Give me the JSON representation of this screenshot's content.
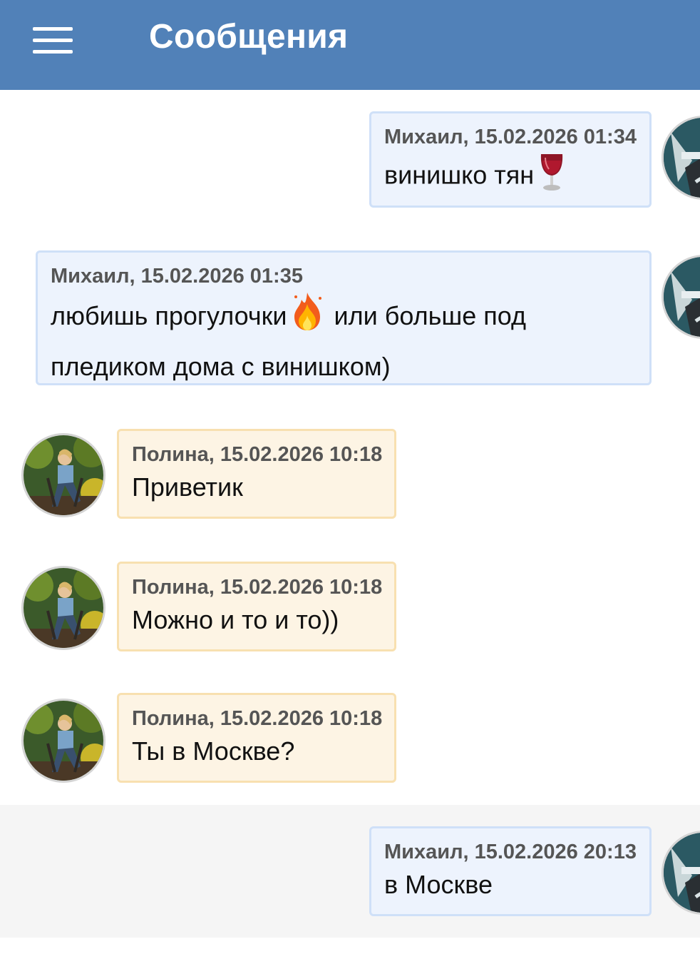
{
  "header": {
    "title": "Сообщения",
    "menu_icon": "hamburger-menu-icon"
  },
  "messages": [
    {
      "direction": "out",
      "author": "Михаил",
      "meta": "Михаил, 15.02.2026 01:34",
      "text": "винишко тян",
      "emoji": "wine-glass-icon"
    },
    {
      "direction": "out",
      "author": "Михаил",
      "meta": "Михаил, 15.02.2026 01:35",
      "text_part1": "любишь прогулочки",
      "emoji": "fire-icon",
      "text_part2": " или больше под пледиком дома с винишком)"
    },
    {
      "direction": "in",
      "author": "Полина",
      "meta": "Полина, 15.02.2026 10:18",
      "text": "Приветик"
    },
    {
      "direction": "in",
      "author": "Полина",
      "meta": "Полина, 15.02.2026 10:18",
      "text": "Можно и то и то))"
    },
    {
      "direction": "in",
      "author": "Полина",
      "meta": "Полина, 15.02.2026 10:18",
      "text": "Ты в Москве?"
    },
    {
      "direction": "out",
      "author": "Михаил",
      "meta": "Михаил, 15.02.2026 20:13",
      "text": "в Москве"
    }
  ],
  "colors": {
    "header_bg": "#5181b8",
    "outgoing_bubble": "#edf3fd",
    "incoming_bubble": "#fdf4e4"
  }
}
